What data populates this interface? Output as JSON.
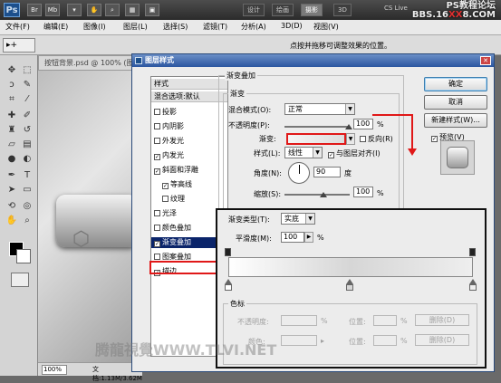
{
  "titlebar": {
    "app_icon": "Ps",
    "icons": [
      "Br",
      "Mb"
    ],
    "workspaces": [
      "设计",
      "绘画",
      "摄影",
      "3D"
    ],
    "active_workspace": "摄影",
    "cs_live": "CS Live",
    "watermark_line1": "PS教程论坛",
    "watermark_line2_a": "BBS.16",
    "watermark_line2_red": "XX",
    "watermark_line2_b": "8.COM"
  },
  "menubar": [
    "文件(F)",
    "编辑(E)",
    "图像(I)",
    "图层(L)",
    "选择(S)",
    "滤镜(T)",
    "分析(A)",
    "3D(D)",
    "视图(V)"
  ],
  "options_bar": {
    "tool_glyph": "▸+",
    "hint": "点按并拖移可调整效果的位置。"
  },
  "document": {
    "tab": "按钮背景.psd @ 100% (图层",
    "zoom": "100%",
    "doc_size": "文档:1.13M/3.62M"
  },
  "dialog": {
    "title": "图层样式",
    "styles_header": "样式",
    "blend_default": "混合选项:默认",
    "style_items": [
      {
        "label": "投影",
        "checked": false
      },
      {
        "label": "内阴影",
        "checked": false
      },
      {
        "label": "外发光",
        "checked": false
      },
      {
        "label": "内发光",
        "checked": true
      },
      {
        "label": "斜面和浮雕",
        "checked": true
      },
      {
        "label": "等高线",
        "checked": true
      },
      {
        "label": "纹理",
        "checked": false
      },
      {
        "label": "光泽",
        "checked": false
      },
      {
        "label": "颜色叠加",
        "checked": false
      },
      {
        "label": "渐变叠加",
        "checked": true
      },
      {
        "label": "图案叠加",
        "checked": false
      },
      {
        "label": "描边",
        "checked": true
      }
    ],
    "section_title": "渐变叠加",
    "group_title": "渐变",
    "blend_mode_label": "混合模式(O):",
    "blend_mode_value": "正常",
    "opacity_label": "不透明度(P):",
    "opacity_value": "100",
    "opacity_unit": "%",
    "gradient_label": "渐变:",
    "reverse_label": "反向(R)",
    "style_label": "样式(L):",
    "style_value": "线性",
    "align_label": "与图层对齐(I)",
    "align_checked": true,
    "angle_label": "角度(N):",
    "angle_value": "90",
    "angle_unit": "度",
    "scale_label": "缩放(S):",
    "scale_value": "100",
    "scale_unit": "%",
    "ok_label": "确定",
    "cancel_label": "取消",
    "new_style_label": "新建样式(W)...",
    "preview_label": "预览(V)",
    "preview_checked": true
  },
  "gradient_editor": {
    "type_label": "渐变类型(T):",
    "type_value": "实底",
    "smoothness_label": "平滑度(M):",
    "smoothness_value": "100",
    "smoothness_unit": "%",
    "stops_title": "色标",
    "opacity_label": "不透明度:",
    "location_label": "位置:",
    "location_label2": "位置:",
    "color_label": "颜色:",
    "pct": "%",
    "pct2": "%",
    "delete_label": "删除(D)",
    "delete_label2": "删除(D)"
  },
  "watermark_bottom": "腾龍視覺WWW.TLVI.NET",
  "colors": {
    "accent_red": "#e01818",
    "selection_blue": "#0a246a",
    "dialog_title": "#2b56a0"
  }
}
